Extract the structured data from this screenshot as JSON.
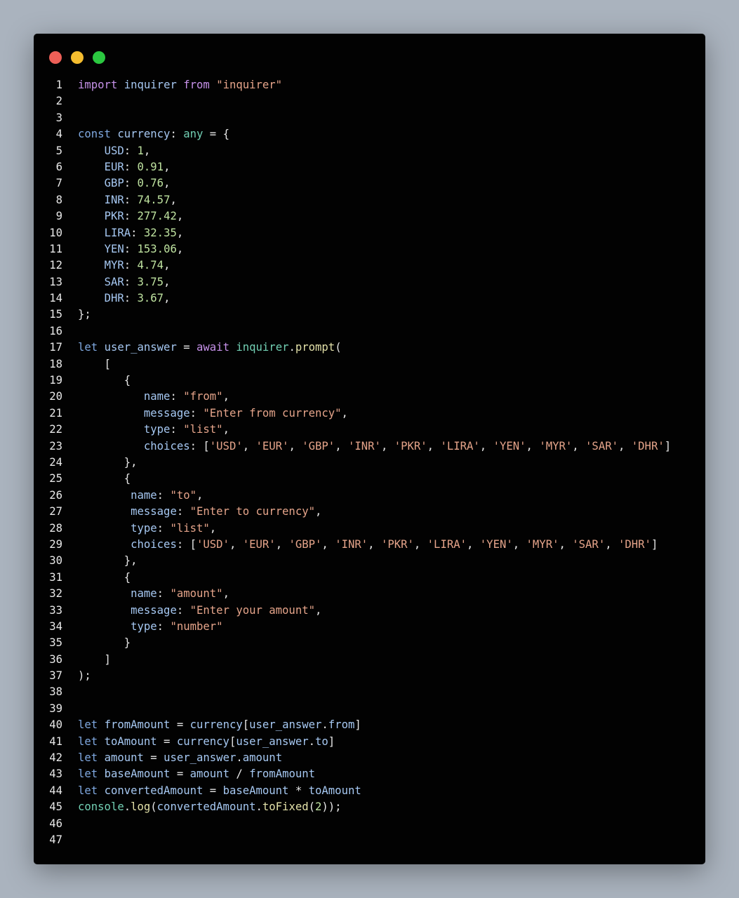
{
  "window": {
    "controls": [
      {
        "name": "close",
        "color": "#ed5f57"
      },
      {
        "name": "minimize",
        "color": "#f5bd2f"
      },
      {
        "name": "maximize",
        "color": "#2bc840"
      }
    ]
  },
  "colors": {
    "kw": "#c792ea",
    "decl": "#7fa8e0",
    "id": "#a6c8f2",
    "plain": "#e6e6e6",
    "str": "#e5a48a",
    "num": "#bfe3a0",
    "type": "#72d0b4",
    "fn": "#e2e0a8",
    "linenum": "#e8e8e8"
  },
  "code": [
    {
      "n": "1",
      "tokens": [
        [
          "kw",
          "import"
        ],
        [
          "plain",
          " "
        ],
        [
          "id",
          "inquirer"
        ],
        [
          "plain",
          " "
        ],
        [
          "kw",
          "from"
        ],
        [
          "plain",
          " "
        ],
        [
          "str",
          "\"inquirer\""
        ]
      ]
    },
    {
      "n": "2",
      "tokens": []
    },
    {
      "n": "3",
      "tokens": []
    },
    {
      "n": "4",
      "tokens": [
        [
          "decl",
          "const"
        ],
        [
          "plain",
          " "
        ],
        [
          "id",
          "currency"
        ],
        [
          "plain",
          ": "
        ],
        [
          "type",
          "any"
        ],
        [
          "plain",
          " = {"
        ]
      ]
    },
    {
      "n": "5",
      "tokens": [
        [
          "plain",
          "    "
        ],
        [
          "id",
          "USD"
        ],
        [
          "plain",
          ": "
        ],
        [
          "num",
          "1"
        ],
        [
          "plain",
          ","
        ]
      ]
    },
    {
      "n": "6",
      "tokens": [
        [
          "plain",
          "    "
        ],
        [
          "id",
          "EUR"
        ],
        [
          "plain",
          ": "
        ],
        [
          "num",
          "0.91"
        ],
        [
          "plain",
          ","
        ]
      ]
    },
    {
      "n": "7",
      "tokens": [
        [
          "plain",
          "    "
        ],
        [
          "id",
          "GBP"
        ],
        [
          "plain",
          ": "
        ],
        [
          "num",
          "0.76"
        ],
        [
          "plain",
          ","
        ]
      ]
    },
    {
      "n": "8",
      "tokens": [
        [
          "plain",
          "    "
        ],
        [
          "id",
          "INR"
        ],
        [
          "plain",
          ": "
        ],
        [
          "num",
          "74.57"
        ],
        [
          "plain",
          ","
        ]
      ]
    },
    {
      "n": "9",
      "tokens": [
        [
          "plain",
          "    "
        ],
        [
          "id",
          "PKR"
        ],
        [
          "plain",
          ": "
        ],
        [
          "num",
          "277.42"
        ],
        [
          "plain",
          ","
        ]
      ]
    },
    {
      "n": "10",
      "tokens": [
        [
          "plain",
          "    "
        ],
        [
          "id",
          "LIRA"
        ],
        [
          "plain",
          ": "
        ],
        [
          "num",
          "32.35"
        ],
        [
          "plain",
          ","
        ]
      ]
    },
    {
      "n": "11",
      "tokens": [
        [
          "plain",
          "    "
        ],
        [
          "id",
          "YEN"
        ],
        [
          "plain",
          ": "
        ],
        [
          "num",
          "153.06"
        ],
        [
          "plain",
          ","
        ]
      ]
    },
    {
      "n": "12",
      "tokens": [
        [
          "plain",
          "    "
        ],
        [
          "id",
          "MYR"
        ],
        [
          "plain",
          ": "
        ],
        [
          "num",
          "4.74"
        ],
        [
          "plain",
          ","
        ]
      ]
    },
    {
      "n": "13",
      "tokens": [
        [
          "plain",
          "    "
        ],
        [
          "id",
          "SAR"
        ],
        [
          "plain",
          ": "
        ],
        [
          "num",
          "3.75"
        ],
        [
          "plain",
          ","
        ]
      ]
    },
    {
      "n": "14",
      "tokens": [
        [
          "plain",
          "    "
        ],
        [
          "id",
          "DHR"
        ],
        [
          "plain",
          ": "
        ],
        [
          "num",
          "3.67"
        ],
        [
          "plain",
          ","
        ]
      ]
    },
    {
      "n": "15",
      "tokens": [
        [
          "plain",
          "};"
        ]
      ]
    },
    {
      "n": "16",
      "tokens": []
    },
    {
      "n": "17",
      "tokens": [
        [
          "decl",
          "let"
        ],
        [
          "plain",
          " "
        ],
        [
          "id",
          "user_answer"
        ],
        [
          "plain",
          " = "
        ],
        [
          "kw",
          "await"
        ],
        [
          "plain",
          " "
        ],
        [
          "type",
          "inquirer"
        ],
        [
          "plain",
          "."
        ],
        [
          "fn",
          "prompt"
        ],
        [
          "plain",
          "("
        ]
      ]
    },
    {
      "n": "18",
      "tokens": [
        [
          "plain",
          "    ["
        ]
      ]
    },
    {
      "n": "19",
      "tokens": [
        [
          "plain",
          "       {"
        ]
      ]
    },
    {
      "n": "20",
      "tokens": [
        [
          "plain",
          "          "
        ],
        [
          "id",
          "name"
        ],
        [
          "plain",
          ": "
        ],
        [
          "str",
          "\"from\""
        ],
        [
          "plain",
          ","
        ]
      ]
    },
    {
      "n": "21",
      "tokens": [
        [
          "plain",
          "          "
        ],
        [
          "id",
          "message"
        ],
        [
          "plain",
          ": "
        ],
        [
          "str",
          "\"Enter from currency\""
        ],
        [
          "plain",
          ","
        ]
      ]
    },
    {
      "n": "22",
      "tokens": [
        [
          "plain",
          "          "
        ],
        [
          "id",
          "type"
        ],
        [
          "plain",
          ": "
        ],
        [
          "str",
          "\"list\""
        ],
        [
          "plain",
          ","
        ]
      ]
    },
    {
      "n": "23",
      "tokens": [
        [
          "plain",
          "          "
        ],
        [
          "id",
          "choices"
        ],
        [
          "plain",
          ": ["
        ],
        [
          "str",
          "'USD'"
        ],
        [
          "plain",
          ", "
        ],
        [
          "str",
          "'EUR'"
        ],
        [
          "plain",
          ", "
        ],
        [
          "str",
          "'GBP'"
        ],
        [
          "plain",
          ", "
        ],
        [
          "str",
          "'INR'"
        ],
        [
          "plain",
          ", "
        ],
        [
          "str",
          "'PKR'"
        ],
        [
          "plain",
          ", "
        ],
        [
          "str",
          "'LIRA'"
        ],
        [
          "plain",
          ", "
        ],
        [
          "str",
          "'YEN'"
        ],
        [
          "plain",
          ", "
        ],
        [
          "str",
          "'MYR'"
        ],
        [
          "plain",
          ", "
        ],
        [
          "str",
          "'SAR'"
        ],
        [
          "plain",
          ", "
        ],
        [
          "str",
          "'DHR'"
        ],
        [
          "plain",
          "]"
        ]
      ]
    },
    {
      "n": "24",
      "tokens": [
        [
          "plain",
          "       },"
        ]
      ]
    },
    {
      "n": "25",
      "tokens": [
        [
          "plain",
          "       {"
        ]
      ]
    },
    {
      "n": "26",
      "tokens": [
        [
          "plain",
          "        "
        ],
        [
          "id",
          "name"
        ],
        [
          "plain",
          ": "
        ],
        [
          "str",
          "\"to\""
        ],
        [
          "plain",
          ","
        ]
      ]
    },
    {
      "n": "27",
      "tokens": [
        [
          "plain",
          "        "
        ],
        [
          "id",
          "message"
        ],
        [
          "plain",
          ": "
        ],
        [
          "str",
          "\"Enter to currency\""
        ],
        [
          "plain",
          ","
        ]
      ]
    },
    {
      "n": "28",
      "tokens": [
        [
          "plain",
          "        "
        ],
        [
          "id",
          "type"
        ],
        [
          "plain",
          ": "
        ],
        [
          "str",
          "\"list\""
        ],
        [
          "plain",
          ","
        ]
      ]
    },
    {
      "n": "29",
      "tokens": [
        [
          "plain",
          "        "
        ],
        [
          "id",
          "choices"
        ],
        [
          "plain",
          ": ["
        ],
        [
          "str",
          "'USD'"
        ],
        [
          "plain",
          ", "
        ],
        [
          "str",
          "'EUR'"
        ],
        [
          "plain",
          ", "
        ],
        [
          "str",
          "'GBP'"
        ],
        [
          "plain",
          ", "
        ],
        [
          "str",
          "'INR'"
        ],
        [
          "plain",
          ", "
        ],
        [
          "str",
          "'PKR'"
        ],
        [
          "plain",
          ", "
        ],
        [
          "str",
          "'LIRA'"
        ],
        [
          "plain",
          ", "
        ],
        [
          "str",
          "'YEN'"
        ],
        [
          "plain",
          ", "
        ],
        [
          "str",
          "'MYR'"
        ],
        [
          "plain",
          ", "
        ],
        [
          "str",
          "'SAR'"
        ],
        [
          "plain",
          ", "
        ],
        [
          "str",
          "'DHR'"
        ],
        [
          "plain",
          "]"
        ]
      ]
    },
    {
      "n": "30",
      "tokens": [
        [
          "plain",
          "       },"
        ]
      ]
    },
    {
      "n": "31",
      "tokens": [
        [
          "plain",
          "       {"
        ]
      ]
    },
    {
      "n": "32",
      "tokens": [
        [
          "plain",
          "        "
        ],
        [
          "id",
          "name"
        ],
        [
          "plain",
          ": "
        ],
        [
          "str",
          "\"amount\""
        ],
        [
          "plain",
          ","
        ]
      ]
    },
    {
      "n": "33",
      "tokens": [
        [
          "plain",
          "        "
        ],
        [
          "id",
          "message"
        ],
        [
          "plain",
          ": "
        ],
        [
          "str",
          "\"Enter your amount\""
        ],
        [
          "plain",
          ","
        ]
      ]
    },
    {
      "n": "34",
      "tokens": [
        [
          "plain",
          "        "
        ],
        [
          "id",
          "type"
        ],
        [
          "plain",
          ": "
        ],
        [
          "str",
          "\"number\""
        ]
      ]
    },
    {
      "n": "35",
      "tokens": [
        [
          "plain",
          "       }"
        ]
      ]
    },
    {
      "n": "36",
      "tokens": [
        [
          "plain",
          "    ]"
        ]
      ]
    },
    {
      "n": "37",
      "tokens": [
        [
          "plain",
          ");"
        ]
      ]
    },
    {
      "n": "38",
      "tokens": []
    },
    {
      "n": "39",
      "tokens": []
    },
    {
      "n": "40",
      "tokens": [
        [
          "decl",
          "let"
        ],
        [
          "plain",
          " "
        ],
        [
          "id",
          "fromAmount"
        ],
        [
          "plain",
          " = "
        ],
        [
          "id",
          "currency"
        ],
        [
          "plain",
          "["
        ],
        [
          "id",
          "user_answer"
        ],
        [
          "plain",
          "."
        ],
        [
          "id",
          "from"
        ],
        [
          "plain",
          "]"
        ]
      ]
    },
    {
      "n": "41",
      "tokens": [
        [
          "decl",
          "let"
        ],
        [
          "plain",
          " "
        ],
        [
          "id",
          "toAmount"
        ],
        [
          "plain",
          " = "
        ],
        [
          "id",
          "currency"
        ],
        [
          "plain",
          "["
        ],
        [
          "id",
          "user_answer"
        ],
        [
          "plain",
          "."
        ],
        [
          "id",
          "to"
        ],
        [
          "plain",
          "]"
        ]
      ]
    },
    {
      "n": "42",
      "tokens": [
        [
          "decl",
          "let"
        ],
        [
          "plain",
          " "
        ],
        [
          "id",
          "amount"
        ],
        [
          "plain",
          " = "
        ],
        [
          "id",
          "user_answer"
        ],
        [
          "plain",
          "."
        ],
        [
          "id",
          "amount"
        ]
      ]
    },
    {
      "n": "43",
      "tokens": [
        [
          "decl",
          "let"
        ],
        [
          "plain",
          " "
        ],
        [
          "id",
          "baseAmount"
        ],
        [
          "plain",
          " = "
        ],
        [
          "id",
          "amount"
        ],
        [
          "plain",
          " / "
        ],
        [
          "id",
          "fromAmount"
        ]
      ]
    },
    {
      "n": "44",
      "tokens": [
        [
          "decl",
          "let"
        ],
        [
          "plain",
          " "
        ],
        [
          "id",
          "convertedAmount"
        ],
        [
          "plain",
          " = "
        ],
        [
          "id",
          "baseAmount"
        ],
        [
          "plain",
          " * "
        ],
        [
          "id",
          "toAmount"
        ]
      ]
    },
    {
      "n": "45",
      "tokens": [
        [
          "type",
          "console"
        ],
        [
          "plain",
          "."
        ],
        [
          "fn",
          "log"
        ],
        [
          "plain",
          "("
        ],
        [
          "id",
          "convertedAmount"
        ],
        [
          "plain",
          "."
        ],
        [
          "fn",
          "toFixed"
        ],
        [
          "plain",
          "("
        ],
        [
          "num",
          "2"
        ],
        [
          "plain",
          "));"
        ]
      ]
    },
    {
      "n": "46",
      "tokens": []
    },
    {
      "n": "47",
      "tokens": []
    }
  ]
}
